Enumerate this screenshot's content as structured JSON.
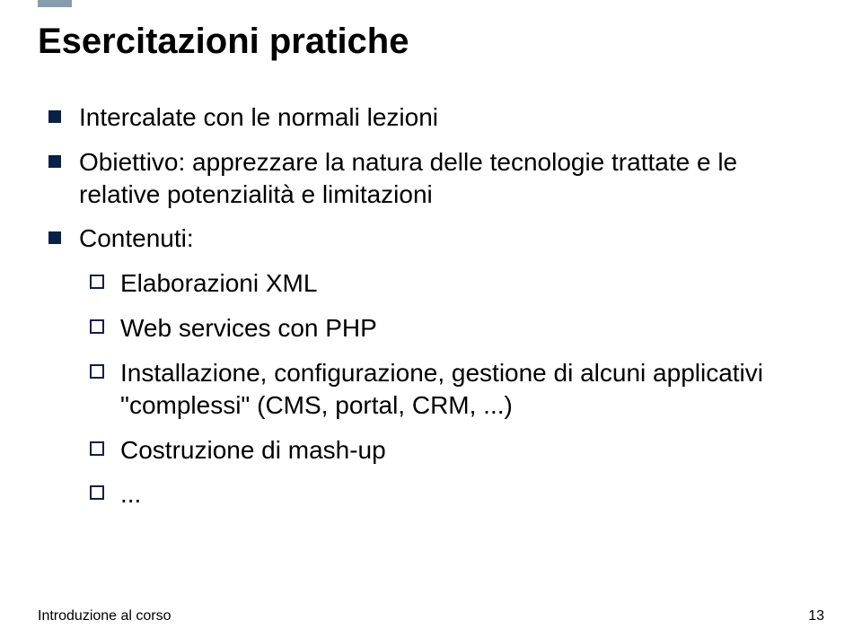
{
  "title": "Esercitazioni pratiche",
  "bullets_l1": {
    "b0": "Intercalate con le normali lezioni",
    "b1": "Obiettivo: apprezzare la natura delle tecnologie trattate e le relative potenzialità e limitazioni",
    "b2": "Contenuti:"
  },
  "bullets_l2": {
    "s0": "Elaborazioni XML",
    "s1": "Web services con PHP",
    "s2": "Installazione, configurazione, gestione di alcuni applicativi \"complessi\" (CMS, portal, CRM, ...)",
    "s3": "Costruzione di mash-up",
    "s4": "..."
  },
  "footer": "Introduzione al corso",
  "page_number": "13"
}
